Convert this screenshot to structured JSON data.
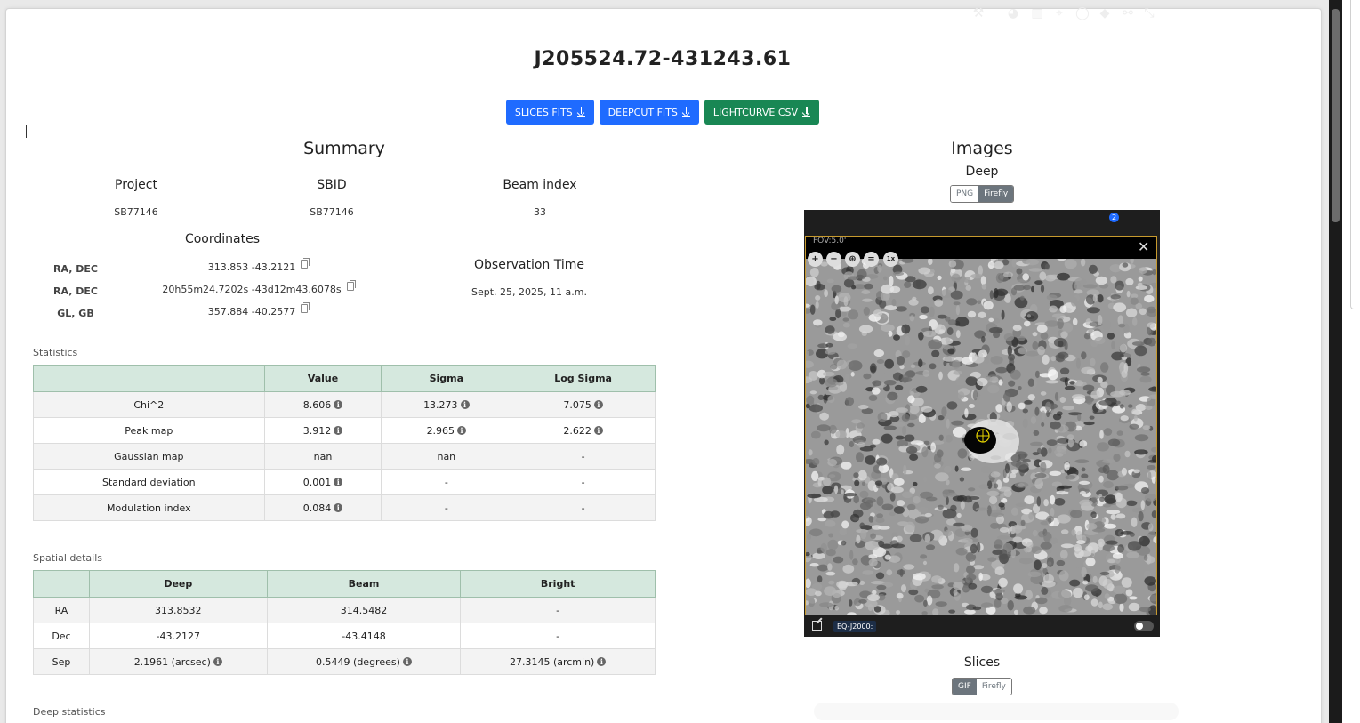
{
  "page": {
    "title": "J205524.72-431243.61",
    "buttons": [
      {
        "label": "SLICES FITS",
        "color": "#1f6bff"
      },
      {
        "label": "DEEPCUT FITS",
        "color": "#1f6bff"
      },
      {
        "label": "LIGHTCURVE CSV",
        "color": "#198754"
      }
    ]
  },
  "summary": {
    "heading": "Summary",
    "project_label": "Project",
    "project_value": "SB77146",
    "sbid_label": "SBID",
    "sbid_value": "SB77146",
    "beam_label": "Beam index",
    "beam_value": "33",
    "coords_heading": "Coordinates",
    "coords": [
      {
        "label": "RA, DEC",
        "value": "313.853 -43.2121"
      },
      {
        "label": "RA, DEC",
        "value": "20h55m24.7202s -43d12m43.6078s"
      },
      {
        "label": "GL, GB",
        "value": "357.884 -40.2577"
      }
    ],
    "obs_label": "Observation Time",
    "obs_value": "Sept. 25, 2025, 11 a.m."
  },
  "statistics": {
    "caption": "Statistics",
    "headers": [
      "",
      "Value",
      "Sigma",
      "Log Sigma"
    ],
    "rows": [
      {
        "name": "Chi^2",
        "value": "8.606",
        "sigma": "13.273",
        "logsigma": "7.075",
        "info": [
          true,
          true,
          true
        ]
      },
      {
        "name": "Peak map",
        "value": "3.912",
        "sigma": "2.965",
        "logsigma": "2.622",
        "info": [
          true,
          true,
          true
        ]
      },
      {
        "name": "Gaussian map",
        "value": "nan",
        "sigma": "nan",
        "logsigma": "-",
        "info": [
          false,
          false,
          false
        ]
      },
      {
        "name": "Standard deviation",
        "value": "0.001",
        "sigma": "-",
        "logsigma": "-",
        "info": [
          true,
          false,
          false
        ]
      },
      {
        "name": "Modulation index",
        "value": "0.084",
        "sigma": "-",
        "logsigma": "-",
        "info": [
          true,
          false,
          false
        ]
      }
    ]
  },
  "spatial": {
    "caption": "Spatial details",
    "headers": [
      "",
      "Deep",
      "Beam",
      "Bright"
    ],
    "rows": [
      {
        "name": "RA",
        "deep": "313.8532",
        "beam": "314.5482",
        "bright": "-",
        "info": [
          false,
          false,
          false
        ]
      },
      {
        "name": "Dec",
        "deep": "-43.2127",
        "beam": "-43.4148",
        "bright": "-",
        "info": [
          false,
          false,
          false
        ]
      },
      {
        "name": "Sep",
        "deep": "2.1961 (arcsec)",
        "beam": "0.5449 (degrees)",
        "bright": "27.3145 (arcmin)",
        "info": [
          true,
          true,
          true
        ]
      }
    ]
  },
  "deep_stats_caption": "Deep statistics",
  "images": {
    "heading": "Images",
    "deep_label": "Deep",
    "deep_toggle": {
      "options": [
        "PNG",
        "Firefly"
      ],
      "selected": "Firefly"
    },
    "viewer": {
      "fov": "FOV:5.0'",
      "coord_system": "EQ-J2000:",
      "layer_count": "2",
      "zoom_buttons": [
        "zoom-in",
        "zoom-out",
        "zoom-fit",
        "zoom-fill",
        "zoom-1x"
      ],
      "zoom_1x_label": "1x",
      "toolbar_icons": [
        "tools-icon",
        "palette-icon",
        "histogram-icon",
        "center-icon",
        "lasso-icon",
        "layers-icon",
        "unlink-icon",
        "expand-icon"
      ]
    },
    "slices_label": "Slices",
    "slices_toggle": {
      "options": [
        "GIF",
        "Firefly"
      ],
      "selected": "GIF"
    }
  }
}
